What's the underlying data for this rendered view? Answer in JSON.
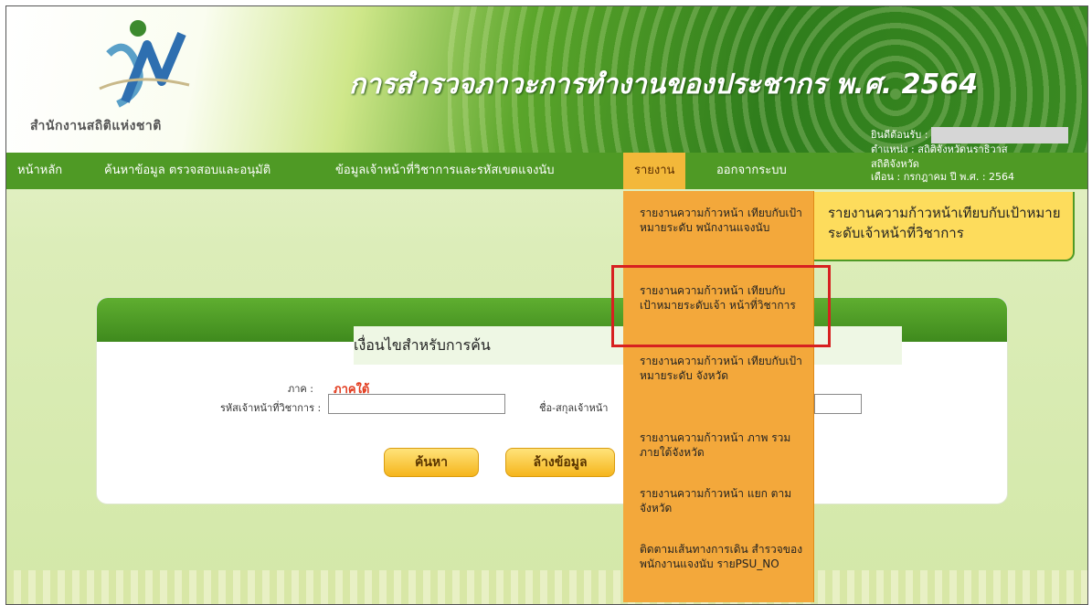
{
  "header": {
    "logo_text": "สำนักงานสถิติแห่งชาติ",
    "site_title": "การสำรวจภาวะการทำงานของประชากร พ.ศ. 2564",
    "welcome_label": "ยินดีต้อนรับ :",
    "position_label": "ตำแหน่ง : สถิติจังหวัดนราธิวาส",
    "org_label": "สถิติจังหวัด",
    "month_label": "เดือน : กรกฎาคม  ปี พ.ศ. : 2564"
  },
  "nav": {
    "items": [
      {
        "label": "หน้าหลัก"
      },
      {
        "label": "ค้นหาข้อมูล ตรวจสอบและอนุมัติ"
      },
      {
        "label": "ข้อมูลเจ้าหน้าที่วิชาการและรหัสเขตแจงนับ"
      },
      {
        "label": "รายงาน"
      },
      {
        "label": "ออกจากระบบ"
      }
    ]
  },
  "report_panel": {
    "title": "รายงานความก้าวหน้าเทียบกับเป้าหมายระดับเจ้าหน้าที่วิชาการ"
  },
  "dropdown": {
    "items": [
      {
        "label": "รายงานความก้าวหน้า เทียบกับเป้าหมายระดับ พนักงานแจงนับ"
      },
      {
        "label": "รายงานความก้าวหน้า เทียบกับเป้าหมายระดับเจ้า หน้าที่วิชาการ"
      },
      {
        "label": "รายงานความก้าวหน้า เทียบกับเป้าหมายระดับ จังหวัด"
      },
      {
        "label": "รายงานความก้าวหน้า ภาพ รวมภายใต้จังหวัด"
      },
      {
        "label": "รายงานความก้าวหน้า แยก ตามจังหวัด"
      },
      {
        "label": "ติดตามเส้นทางการเดิน สำรวจของพนักงานแจงนับ รายPSU_NO"
      }
    ]
  },
  "search": {
    "title": "เงื่อนไขสำหรับการค้น",
    "region_label": "ภาค :",
    "region_value": "ภาคใต้",
    "staff_code_label": "รหัสเจ้าหน้าที่วิชาการ :",
    "staff_code_value": "",
    "staff_name_label": "ชื่อ-สกุลเจ้าหน้า",
    "staff_name_value": "",
    "search_button": "ค้นหา",
    "clear_button": "ล้างข้อมูล"
  },
  "colors": {
    "nav_green": "#4f9a25",
    "menu_orange": "#f3a83b",
    "highlight_red": "#d72020",
    "region_red": "#e23b1e"
  }
}
